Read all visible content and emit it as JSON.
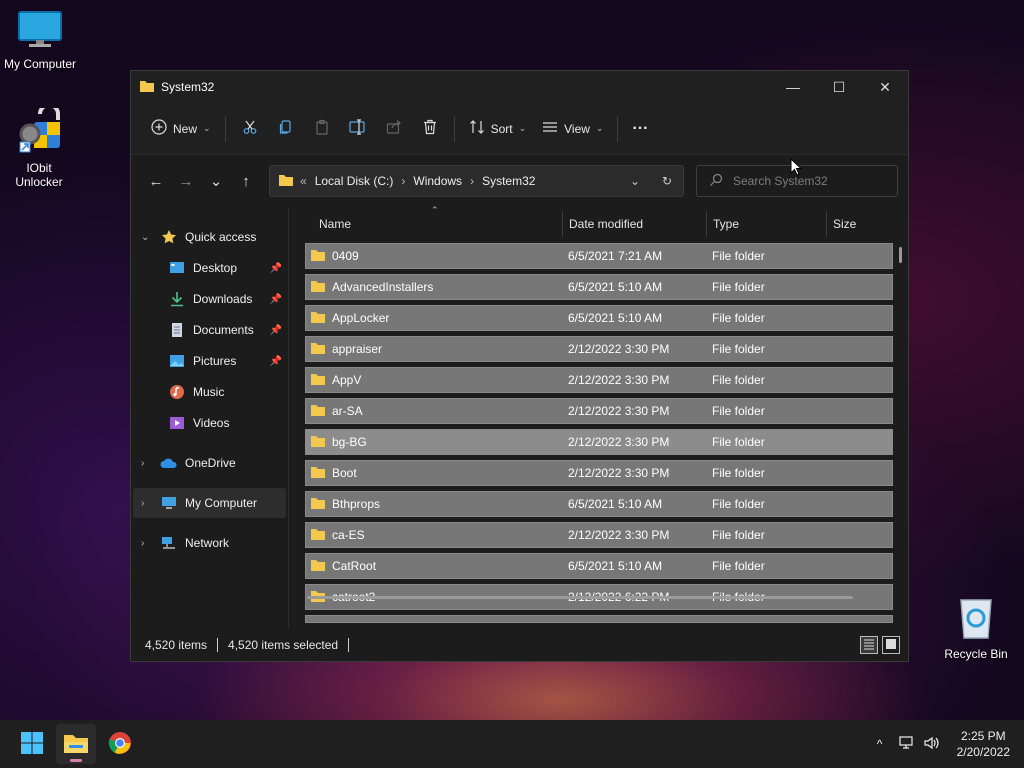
{
  "desktop": {
    "icons": [
      {
        "label": "My Computer"
      },
      {
        "label": "IObit Unlocker"
      },
      {
        "label": "Recycle Bin"
      }
    ]
  },
  "window": {
    "title": "System32",
    "controls": {
      "minimize": "—",
      "maximize": "☐",
      "close": "✕"
    }
  },
  "command_bar": {
    "new_label": "New",
    "sort_label": "Sort",
    "view_label": "View",
    "more_label": "···"
  },
  "address_bar": {
    "overflow": "«",
    "crumbs": [
      "Local Disk (C:)",
      "Windows",
      "System32"
    ]
  },
  "search": {
    "placeholder": "Search System32"
  },
  "sidebar": {
    "items": [
      {
        "label": "Quick access"
      },
      {
        "label": "Desktop"
      },
      {
        "label": "Downloads"
      },
      {
        "label": "Documents"
      },
      {
        "label": "Pictures"
      },
      {
        "label": "Music"
      },
      {
        "label": "Videos"
      },
      {
        "label": "OneDrive"
      },
      {
        "label": "My Computer"
      },
      {
        "label": "Network"
      }
    ]
  },
  "file_list": {
    "columns": [
      "Name",
      "Date modified",
      "Type",
      "Size"
    ],
    "rows": [
      {
        "name": "0409",
        "date": "6/5/2021 7:21 AM",
        "type": "File folder"
      },
      {
        "name": "AdvancedInstallers",
        "date": "6/5/2021 5:10 AM",
        "type": "File folder"
      },
      {
        "name": "AppLocker",
        "date": "6/5/2021 5:10 AM",
        "type": "File folder"
      },
      {
        "name": "appraiser",
        "date": "2/12/2022 3:30 PM",
        "type": "File folder"
      },
      {
        "name": "AppV",
        "date": "2/12/2022 3:30 PM",
        "type": "File folder"
      },
      {
        "name": "ar-SA",
        "date": "2/12/2022 3:30 PM",
        "type": "File folder"
      },
      {
        "name": "bg-BG",
        "date": "2/12/2022 3:30 PM",
        "type": "File folder"
      },
      {
        "name": "Boot",
        "date": "2/12/2022 3:30 PM",
        "type": "File folder"
      },
      {
        "name": "Bthprops",
        "date": "6/5/2021 5:10 AM",
        "type": "File folder"
      },
      {
        "name": "ca-ES",
        "date": "2/12/2022 3:30 PM",
        "type": "File folder"
      },
      {
        "name": "CatRoot",
        "date": "6/5/2021 5:10 AM",
        "type": "File folder"
      },
      {
        "name": "catroot2",
        "date": "2/12/2022 6:22 PM",
        "type": "File folder"
      }
    ]
  },
  "status_bar": {
    "item_count": "4,520 items",
    "selected_count": "4,520 items selected"
  },
  "taskbar": {
    "time": "2:25 PM",
    "date": "2/20/2022"
  },
  "colors": {
    "folder": "#f2c94c",
    "selected_row": "#777777",
    "accent": "#4cc2ff"
  }
}
